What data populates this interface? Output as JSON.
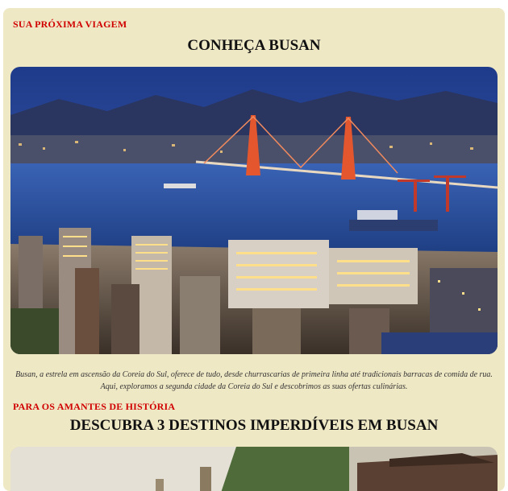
{
  "section1": {
    "kicker": "SUA PRÓXIMA VIAGEM",
    "title": "CONHEÇA BUSAN",
    "image_label": "busan-night-harbor-photo",
    "caption_line1": "Busan, a estrela em ascensão da Coreia do Sul, oferece de tudo, desde churrascarias de primeira linha até tradicionais barracas de comida de rua.",
    "caption_line2": "Aqui, exploramos a segunda cidade da Coreia do Sul e descobrimos as suas ofertas culinárias."
  },
  "section2": {
    "kicker": "PARA OS AMANTES DE HISTÓRIA",
    "title": "DESCUBRA 3 DESTINOS IMPERDÍVEIS EM BUSAN",
    "image_label": "busan-temple-photo"
  },
  "colors": {
    "card_bg": "#efe8c5",
    "kicker": "#d00000",
    "title": "#111111"
  }
}
